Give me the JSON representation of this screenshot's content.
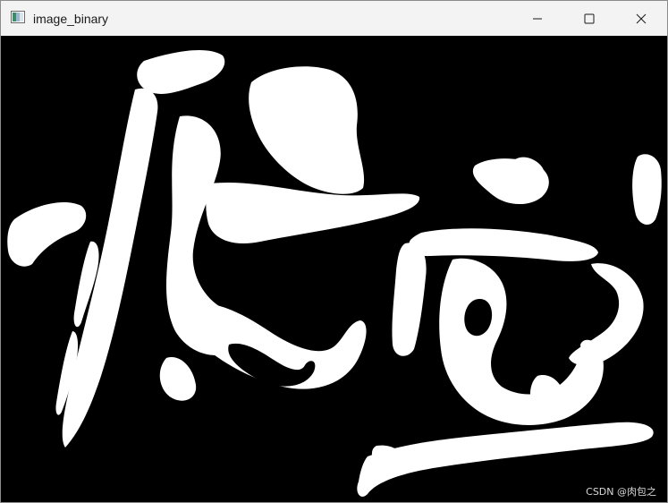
{
  "window": {
    "title": "image_binary"
  },
  "titlebar": {
    "icons": {
      "app": "app-icon",
      "minimize": "minimize-icon",
      "maximize": "maximize-icon",
      "close": "close-icon"
    }
  },
  "image": {
    "description_type": "binary-calligraphy",
    "foreground": "#ffffff",
    "background": "#000000"
  },
  "watermark": {
    "text": "CSDN @肉包之"
  }
}
